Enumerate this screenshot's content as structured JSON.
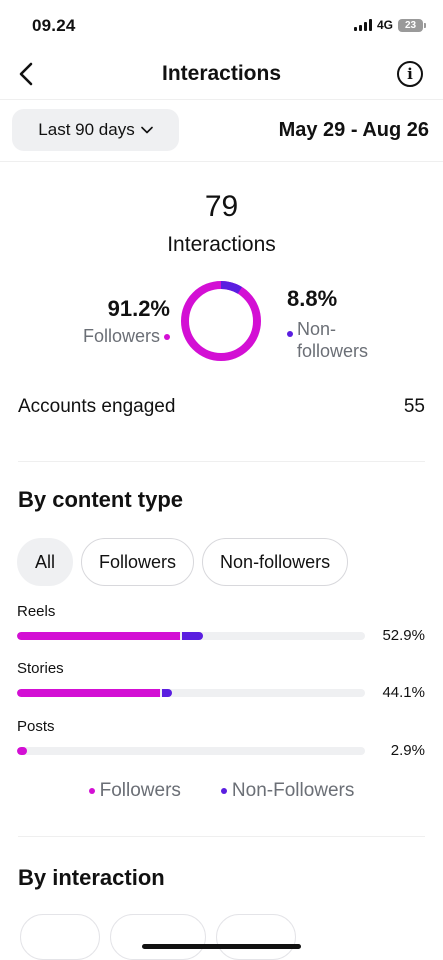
{
  "status_bar": {
    "time": "09.24",
    "network": "4G",
    "battery": "23"
  },
  "nav": {
    "title": "Interactions",
    "back_icon": "chevron-left-icon",
    "info_icon": "info-icon"
  },
  "date_range": {
    "selected": "Last 90 days",
    "dates": "May 29 - Aug 26"
  },
  "summary": {
    "total": "79",
    "label": "Interactions",
    "followers_pct": "91.2%",
    "followers_label": "Followers",
    "non_followers_pct": "8.8%",
    "non_followers_label": "Non-followers",
    "followers_fraction": 0.912,
    "non_followers_fraction": 0.088
  },
  "accounts_engaged": {
    "label": "Accounts engaged",
    "value": "55"
  },
  "by_content_type": {
    "title": "By content type",
    "filters": [
      "All",
      "Followers",
      "Non-followers"
    ],
    "active_filter": "All",
    "rows": [
      {
        "label": "Reels",
        "value": "52.9%",
        "followers_share": 0.469,
        "non_followers_share": 0.06
      },
      {
        "label": "Stories",
        "value": "44.1%",
        "followers_share": 0.412,
        "non_followers_share": 0.029
      },
      {
        "label": "Posts",
        "value": "2.9%",
        "followers_share": 0.029,
        "non_followers_share": 0.0
      }
    ],
    "legend": {
      "followers": "Followers",
      "non_followers": "Non-Followers"
    }
  },
  "by_interaction": {
    "title": "By interaction"
  },
  "colors": {
    "followers": "#d30fd4",
    "non_followers": "#5a1ee0",
    "track": "#eff0f2"
  }
}
